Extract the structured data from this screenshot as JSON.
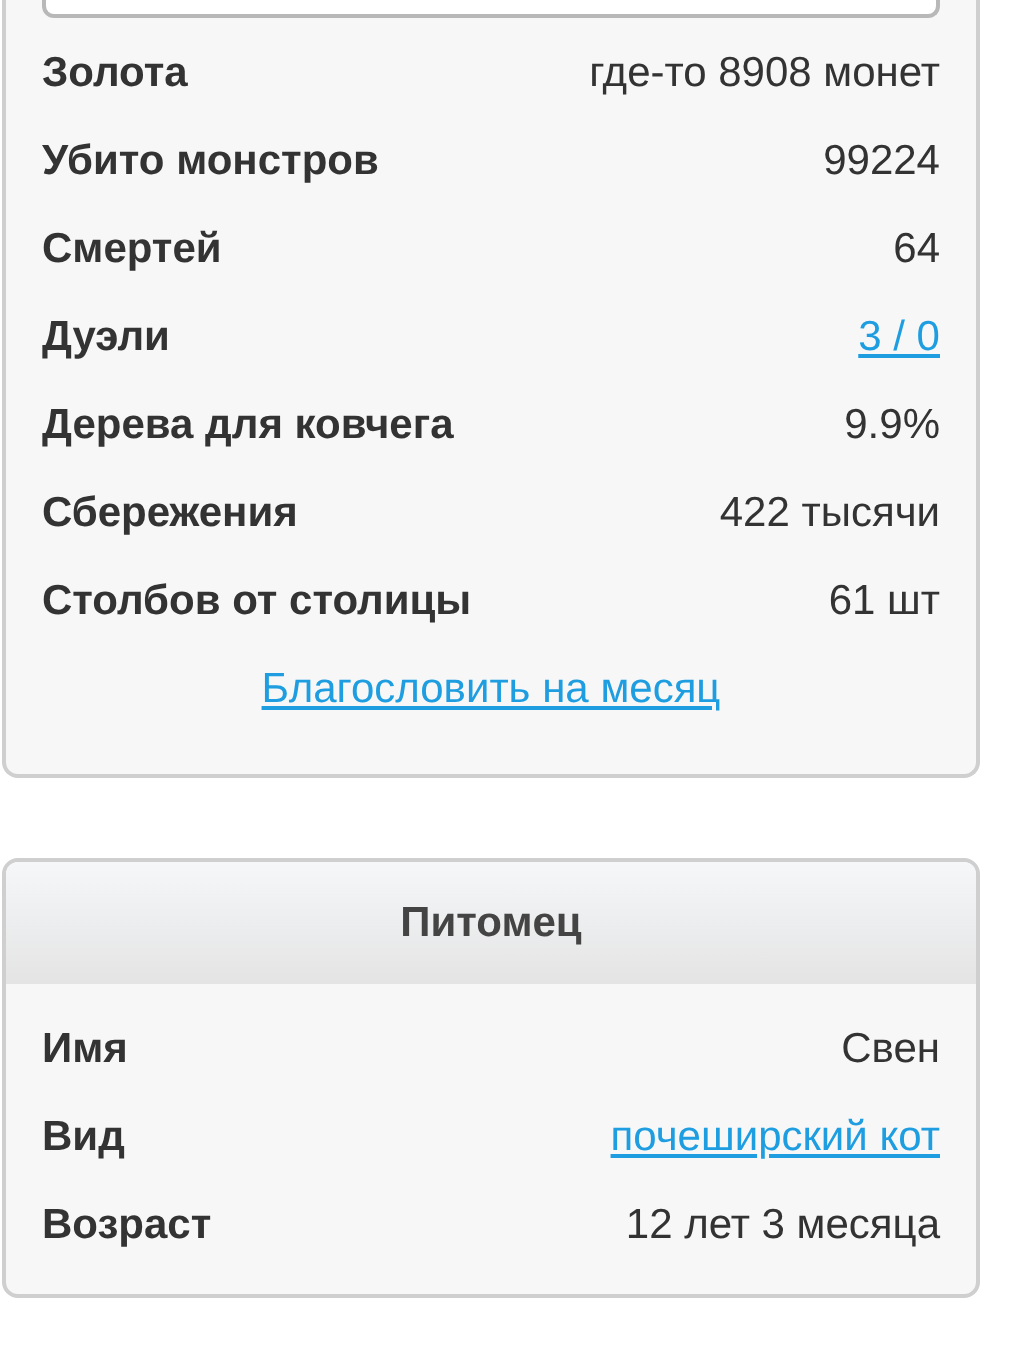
{
  "stats": {
    "rows": [
      {
        "label": "Золота",
        "value": "где-то 8908 монет",
        "kind": "text"
      },
      {
        "label": "Убито монстров",
        "value": "99224",
        "kind": "text"
      },
      {
        "label": "Смертей",
        "value": "64",
        "kind": "text"
      },
      {
        "label": "Дуэли",
        "value": "3 / 0",
        "kind": "link"
      },
      {
        "label": "Дерева для ковчега",
        "value": "9.9%",
        "kind": "text"
      },
      {
        "label": "Сбережения",
        "value": "422 тысячи",
        "kind": "text"
      },
      {
        "label": "Столбов от столицы",
        "value": "61 шт",
        "kind": "text"
      }
    ],
    "action_link": "Благословить на месяц"
  },
  "pet": {
    "title": "Питомец",
    "rows": [
      {
        "label": "Имя",
        "value": "Свен",
        "kind": "text"
      },
      {
        "label": "Вид",
        "value": "почеширский кот",
        "kind": "link"
      },
      {
        "label": "Возраст",
        "value": "12 лет 3 месяца",
        "kind": "text"
      }
    ]
  }
}
